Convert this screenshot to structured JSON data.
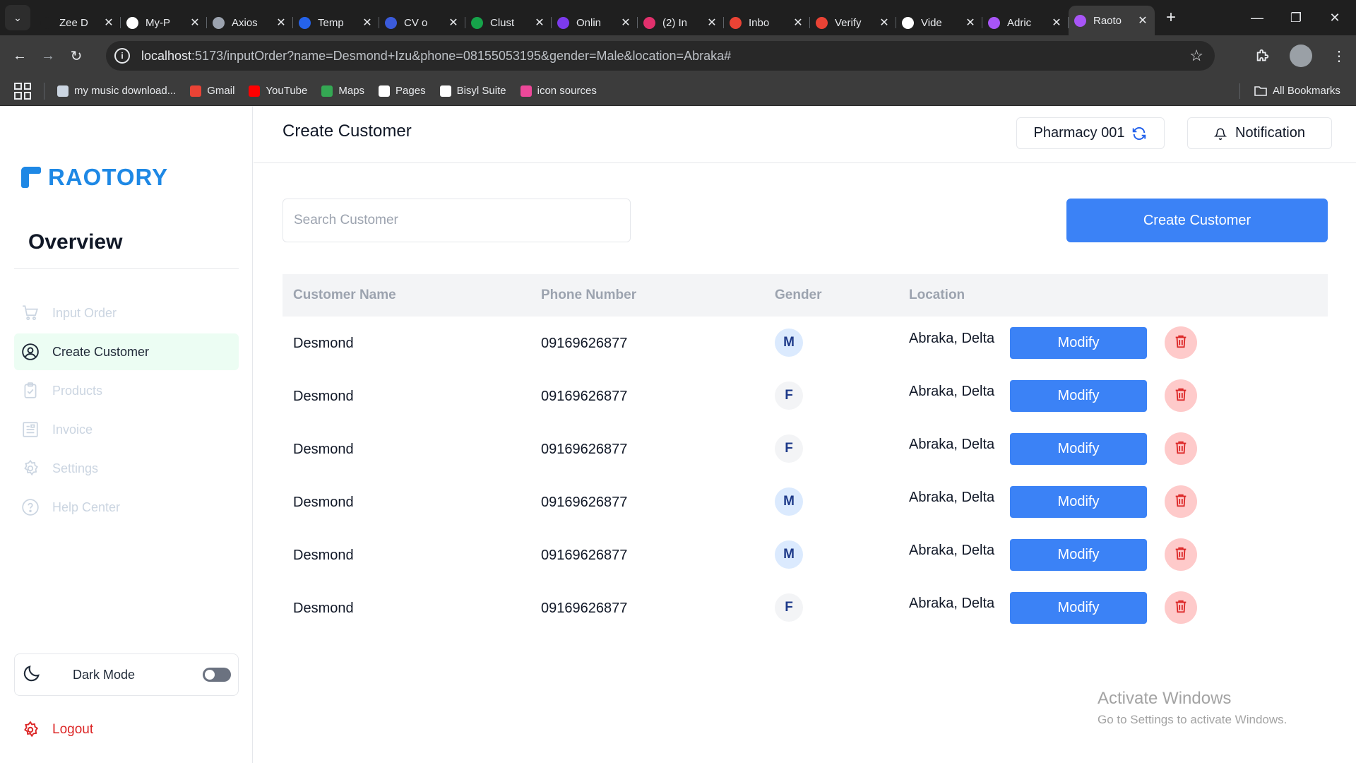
{
  "browser": {
    "tabs": [
      {
        "label": "Zee D",
        "icon": "zee-icon",
        "color": "#1f1f1f"
      },
      {
        "label": "My-P",
        "icon": "github-icon",
        "color": "#ffffff"
      },
      {
        "label": "Axios",
        "icon": "axios-icon",
        "color": "#9ca3af"
      },
      {
        "label": "Temp",
        "icon": "template-icon",
        "color": "#2563eb"
      },
      {
        "label": "CV o",
        "icon": "cv-icon",
        "color": "#3b5bdb"
      },
      {
        "label": "Clust",
        "icon": "mongodb-icon",
        "color": "#16a34a"
      },
      {
        "label": "Onlin",
        "icon": "online-icon",
        "color": "#7c3aed"
      },
      {
        "label": "(2) In",
        "icon": "instagram-icon",
        "color": "#e1306c"
      },
      {
        "label": "Inbo",
        "icon": "gmail-icon",
        "color": "#ea4335"
      },
      {
        "label": "Verify",
        "icon": "gmail-icon",
        "color": "#ea4335"
      },
      {
        "label": "Vide",
        "icon": "video-icon",
        "color": "#ffffff"
      },
      {
        "label": "Adric",
        "icon": "vite-icon",
        "color": "#a855f7"
      },
      {
        "label": "Raoto",
        "icon": "vite-icon",
        "color": "#a855f7",
        "active": true
      }
    ],
    "url_host": "localhost",
    "url_rest": ":5173/inputOrder?name=Desmond+Izu&phone=08155053195&gender=Male&location=Abraka#",
    "bookmarks": [
      {
        "label": "my music download...",
        "icon": "music-icon",
        "color": "#cbd5e1"
      },
      {
        "label": "Gmail",
        "icon": "gmail-icon",
        "color": "#ea4335"
      },
      {
        "label": "YouTube",
        "icon": "youtube-icon",
        "color": "#ff0000"
      },
      {
        "label": "Maps",
        "icon": "maps-icon",
        "color": "#34a853"
      },
      {
        "label": "Pages",
        "icon": "github-icon",
        "color": "#ffffff"
      },
      {
        "label": "Bisyl Suite",
        "icon": "globe-icon",
        "color": "#ffffff"
      },
      {
        "label": "icon sources",
        "icon": "icon-sources-icon",
        "color": "#ec4899"
      }
    ],
    "all_bookmarks": "All Bookmarks"
  },
  "sidebar": {
    "brand": "RAOTORY",
    "section_title": "Overview",
    "items": [
      {
        "label": "Input Order",
        "icon": "cart-icon"
      },
      {
        "label": "Create Customer",
        "icon": "user-circle-icon",
        "active": true
      },
      {
        "label": "Products",
        "icon": "clipboard-icon"
      },
      {
        "label": "Invoice",
        "icon": "invoice-icon"
      },
      {
        "label": "Settings",
        "icon": "gear-icon"
      },
      {
        "label": "Help Center",
        "icon": "help-icon"
      }
    ],
    "dark_mode_label": "Dark Mode",
    "dark_mode_on": false,
    "logout_label": "Logout"
  },
  "header": {
    "title": "Create Customer",
    "pharmacy_label": "Pharmacy 001",
    "notification_label": "Notification"
  },
  "toolbar": {
    "search_placeholder": "Search Customer",
    "create_button": "Create Customer"
  },
  "table": {
    "columns": [
      "Customer Name",
      "Phone Number",
      "Gender",
      "Location"
    ],
    "rows": [
      {
        "name": "Desmond",
        "phone": "09169626877",
        "gender": "M",
        "location": "Abraka, Delta"
      },
      {
        "name": "Desmond",
        "phone": "09169626877",
        "gender": "F",
        "location": "Abraka, Delta"
      },
      {
        "name": "Desmond",
        "phone": "09169626877",
        "gender": "F",
        "location": "Abraka, Delta"
      },
      {
        "name": "Desmond",
        "phone": "09169626877",
        "gender": "M",
        "location": "Abraka, Delta"
      },
      {
        "name": "Desmond",
        "phone": "09169626877",
        "gender": "M",
        "location": "Abraka, Delta"
      },
      {
        "name": "Desmond",
        "phone": "09169626877",
        "gender": "F",
        "location": "Abraka, Delta"
      }
    ],
    "modify_label": "Modify"
  },
  "watermark": {
    "line1": "Activate Windows",
    "line2": "Go to Settings to activate Windows."
  },
  "colors": {
    "accent": "#3b82f6",
    "brand": "#1e88e5",
    "active_nav_bg": "#ecfdf3",
    "danger": "#dc2626"
  }
}
